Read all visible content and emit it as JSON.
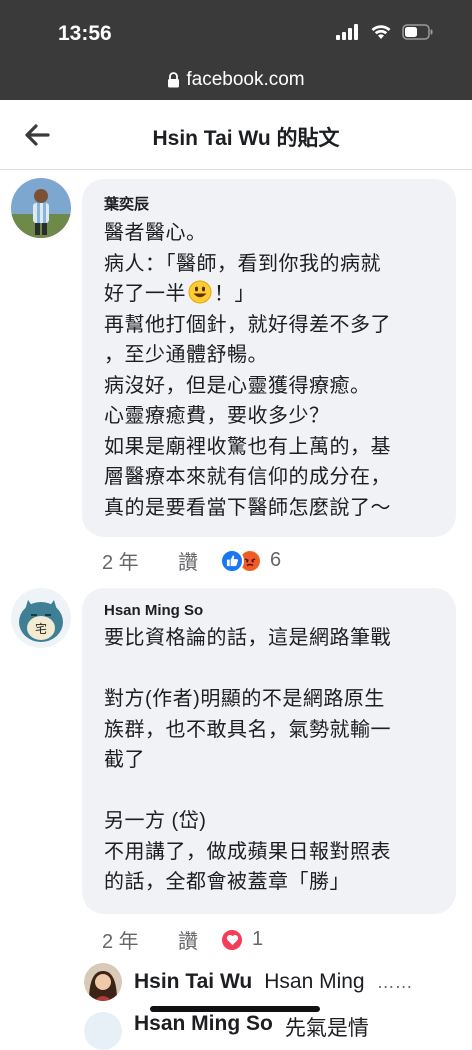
{
  "status": {
    "time": "13:56"
  },
  "url_bar": {
    "domain": "facebook.com"
  },
  "header": {
    "title": "Hsin Tai Wu 的貼文"
  },
  "comments": [
    {
      "author": "葉奕辰",
      "lines": [
        "醫者醫心。",
        "病人：「醫師，看到你我的病就",
        "好了一半",
        "！」",
        "再幫他打個針，就好得差不多了",
        "，至少通體舒暢。",
        "病沒好，但是心靈獲得療癒。",
        "心靈療癒費，要收多少？",
        "如果是廟裡收驚也有上萬的，基",
        "層醫療本來就有信仰的成分在，",
        "真的是要看當下醫師怎麼說了～"
      ],
      "time": "2 年",
      "like_label": "讚",
      "reaction_count": "6",
      "reactions": [
        "like-icon",
        "angry-icon"
      ]
    },
    {
      "author": "Hsan Ming So",
      "lines": [
        "要比資格論的話，這是網路筆戰",
        "",
        "對方(作者)明顯的不是網路原生",
        "族群，也不敢具名，氣勢就輸一",
        "截了",
        "",
        "另一方 (岱)",
        "不用講了，做成蘋果日報對照表",
        "的話，全都會被蓋章「勝」"
      ],
      "time": "2 年",
      "like_label": "讚",
      "reaction_count": "1",
      "reactions": [
        "love-icon"
      ]
    }
  ],
  "reply_preview": {
    "name": "Hsin Tai Wu",
    "text": "Hsan Ming",
    "more": "……"
  },
  "next_reply_preview": {
    "name": "Hsan Ming So",
    "text": "先氣是情"
  },
  "colors": {
    "status_bg": "#3a3a3a",
    "bubble_bg": "#f0f2f5",
    "like_blue": "#1877f2",
    "love_red": "#f33e58",
    "angry_orange": "#e9710f"
  }
}
